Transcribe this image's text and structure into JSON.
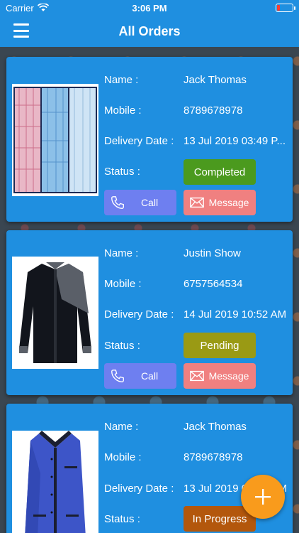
{
  "status_bar": {
    "carrier": "Carrier",
    "time": "3:06 PM"
  },
  "navbar": {
    "title": "All Orders"
  },
  "labels": {
    "name": "Name :",
    "mobile": "Mobile :",
    "delivery_date": "Delivery Date :",
    "status": "Status :",
    "call": "Call",
    "message": "Message"
  },
  "orders": [
    {
      "name": "Jack Thomas",
      "mobile": "8789678978",
      "delivery_date": "13 Jul 2019 03:49 P...",
      "status": "Completed",
      "status_color": "#4b9a1e",
      "product_icon": "checked-shirts-image"
    },
    {
      "name": "Justin Show",
      "mobile": "6757564534",
      "delivery_date": "14 Jul 2019 10:52 AM",
      "status": "Pending",
      "status_color": "#9a9a14",
      "product_icon": "dark-shirt-image"
    },
    {
      "name": "Jack Thomas",
      "mobile": "8789678978",
      "delivery_date": "13 Jul 2019 03:49 PM",
      "status": "In Progress",
      "status_color": "#b3570c",
      "product_icon": "blue-vest-image"
    }
  ],
  "colors": {
    "header": "#1f8fe0",
    "card": "#1f8fe0",
    "call_button": "#6e7ff0",
    "message_button": "#f08080",
    "fab": "#f99b1c"
  },
  "fab_icon": "plus-icon"
}
